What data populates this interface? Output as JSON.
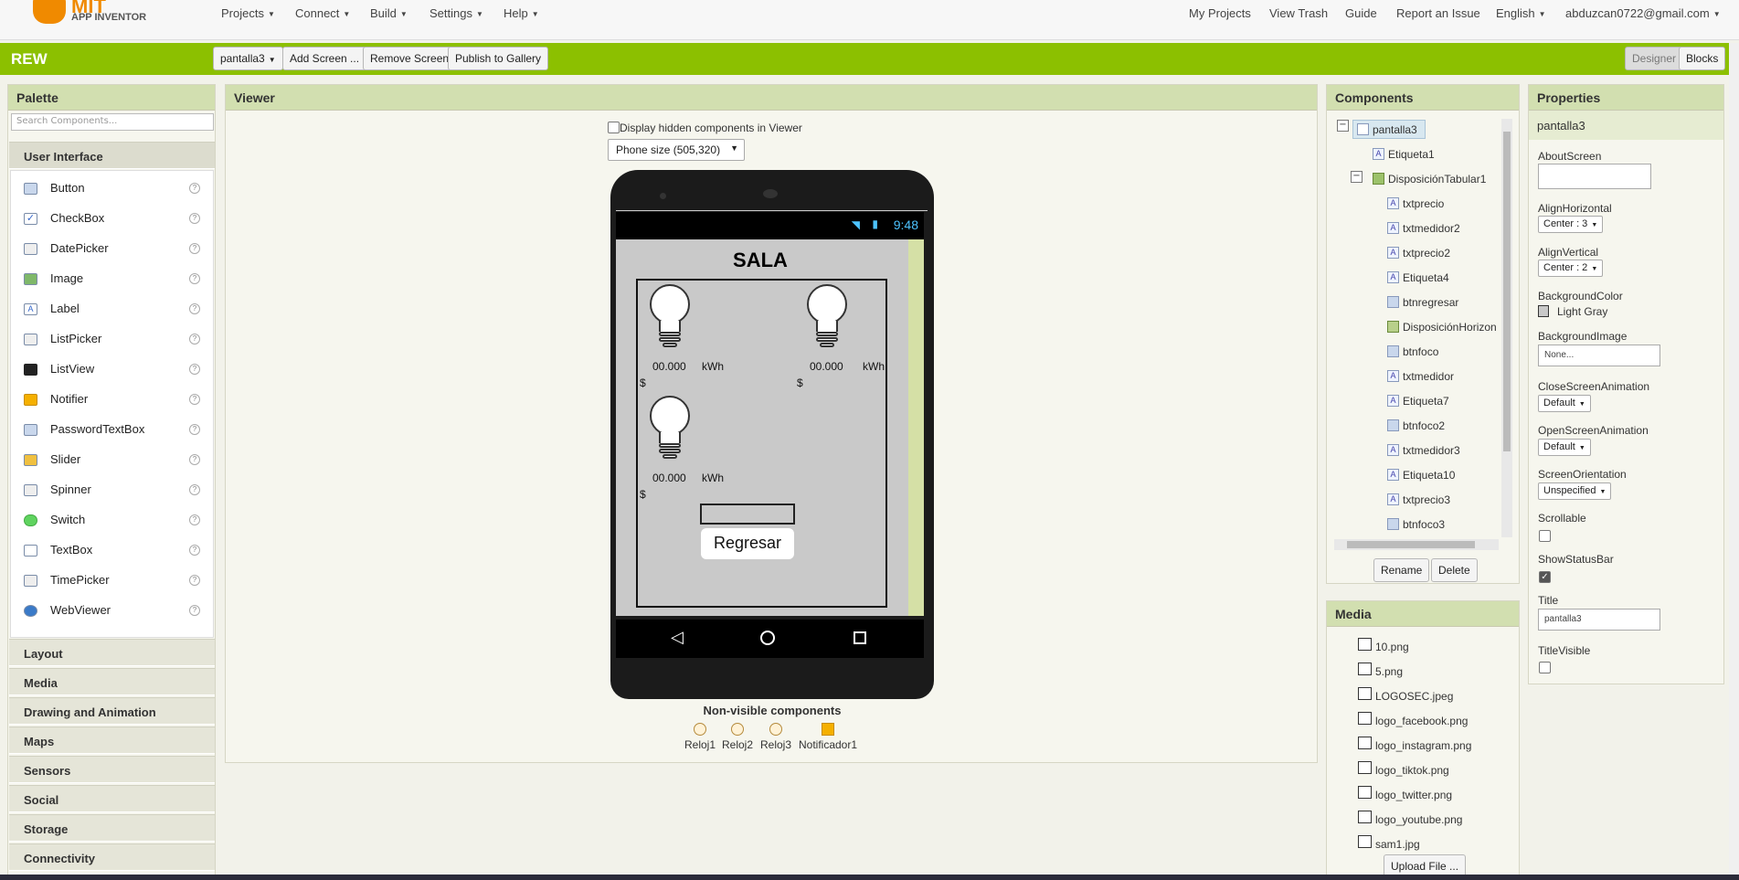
{
  "topbar": {
    "logo_title": "MIT",
    "logo_subtitle": "APP INVENTOR",
    "menus": [
      "Projects",
      "Connect",
      "Build",
      "Settings",
      "Help"
    ],
    "links": [
      "My Projects",
      "View Trash",
      "Guide",
      "Report an Issue"
    ],
    "language": "English",
    "account": "abduzcan0722@gmail.com"
  },
  "toolbar": {
    "project_name": "REW",
    "screen_select": "pantalla3",
    "add_screen": "Add Screen ...",
    "remove_screen": "Remove Screen",
    "publish": "Publish to Gallery",
    "designer": "Designer",
    "blocks": "Blocks"
  },
  "palette": {
    "title": "Palette",
    "search_placeholder": "Search Components...",
    "open_category": "User Interface",
    "items": [
      "Button",
      "CheckBox",
      "DatePicker",
      "Image",
      "Label",
      "ListPicker",
      "ListView",
      "Notifier",
      "PasswordTextBox",
      "Slider",
      "Spinner",
      "Switch",
      "TextBox",
      "TimePicker",
      "WebViewer"
    ],
    "help_glyph": "?",
    "categories": [
      "Layout",
      "Media",
      "Drawing and Animation",
      "Maps",
      "Sensors",
      "Social",
      "Storage",
      "Connectivity"
    ]
  },
  "viewer": {
    "title": "Viewer",
    "hidden_label": "Display hidden components in Viewer",
    "phone_size": "Phone size (505,320)",
    "clock": "9:48",
    "screen_title": "SALA",
    "readings": [
      {
        "value": "00.000",
        "unit": "kWh",
        "currency": "$"
      },
      {
        "value": "00.000",
        "unit": "kWh",
        "currency": "$"
      },
      {
        "value": "00.000",
        "unit": "kWh",
        "currency": "$"
      }
    ],
    "back_button": "Regresar",
    "nonvisible_title": "Non-visible components",
    "nonvisible": [
      "Reloj1",
      "Reloj2",
      "Reloj3",
      "Notificador1"
    ]
  },
  "components": {
    "title": "Components",
    "root": "pantalla3",
    "items": [
      {
        "name": "Etiqueta1",
        "level": 1,
        "icon": "label-icon"
      },
      {
        "name": "DisposiciónTabular1",
        "level": 1,
        "icon": "table-arrangement-icon"
      },
      {
        "name": "txtprecio",
        "level": 2,
        "icon": "label-icon"
      },
      {
        "name": "txtmedidor2",
        "level": 2,
        "icon": "label-icon"
      },
      {
        "name": "txtprecio2",
        "level": 2,
        "icon": "label-icon"
      },
      {
        "name": "Etiqueta4",
        "level": 2,
        "icon": "label-icon"
      },
      {
        "name": "btnregresar",
        "level": 2,
        "icon": "button-icon"
      },
      {
        "name": "DisposiciónHorizon",
        "level": 2,
        "icon": "horizontal-arrangement-icon"
      },
      {
        "name": "btnfoco",
        "level": 2,
        "icon": "button-icon"
      },
      {
        "name": "txtmedidor",
        "level": 2,
        "icon": "label-icon"
      },
      {
        "name": "Etiqueta7",
        "level": 2,
        "icon": "label-icon"
      },
      {
        "name": "btnfoco2",
        "level": 2,
        "icon": "button-icon"
      },
      {
        "name": "txtmedidor3",
        "level": 2,
        "icon": "label-icon"
      },
      {
        "name": "Etiqueta10",
        "level": 2,
        "icon": "label-icon"
      },
      {
        "name": "txtprecio3",
        "level": 2,
        "icon": "label-icon"
      },
      {
        "name": "btnfoco3",
        "level": 2,
        "icon": "button-icon"
      }
    ],
    "rename": "Rename",
    "delete": "Delete"
  },
  "media": {
    "title": "Media",
    "files": [
      "10.png",
      "5.png",
      "LOGOSEC.jpeg",
      "logo_facebook.png",
      "logo_instagram.png",
      "logo_tiktok.png",
      "logo_twitter.png",
      "logo_youtube.png",
      "sam1.jpg"
    ],
    "upload": "Upload File ..."
  },
  "properties": {
    "title": "Properties",
    "component": "pantalla3",
    "about_label": "AboutScreen",
    "align_h_label": "AlignHorizontal",
    "align_h_value": "Center : 3",
    "align_v_label": "AlignVertical",
    "align_v_value": "Center : 2",
    "bg_color_label": "BackgroundColor",
    "bg_color_value": "Light Gray",
    "bg_image_label": "BackgroundImage",
    "bg_image_value": "None...",
    "close_anim_label": "CloseScreenAnimation",
    "close_anim_value": "Default",
    "open_anim_label": "OpenScreenAnimation",
    "open_anim_value": "Default",
    "orientation_label": "ScreenOrientation",
    "orientation_value": "Unspecified",
    "scrollable_label": "Scrollable",
    "scrollable": false,
    "statusbar_label": "ShowStatusBar",
    "statusbar": true,
    "title_label": "Title",
    "title_value": "pantalla3",
    "title_visible_label": "TitleVisible",
    "title_visible": false
  }
}
